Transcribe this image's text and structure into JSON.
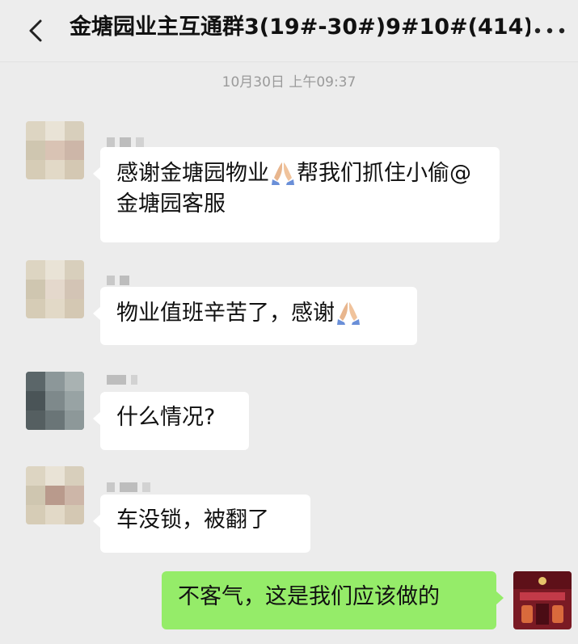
{
  "header": {
    "title": "金塘园业主互通群3(19#-30#)9#10#(414)",
    "back_icon": "chevron-left-icon",
    "more_icon": "more-horizontal-icon"
  },
  "timestamp": "10月30日 上午09:37",
  "colors": {
    "background": "#ececec",
    "incoming_bubble": "#ffffff",
    "outgoing_bubble": "#95ec69"
  },
  "messages": [
    {
      "direction": "incoming",
      "text_before": "感谢金塘园物业",
      "emoji": "folded-hands-icon",
      "text_after": "帮我们抓住小偷@金塘园客服"
    },
    {
      "direction": "incoming",
      "text_before": "物业值班辛苦了，感谢",
      "emoji": "folded-hands-icon"
    },
    {
      "direction": "incoming",
      "text": "什么情况?"
    },
    {
      "direction": "incoming",
      "text": "车没锁，被翻了"
    },
    {
      "direction": "outgoing",
      "text": "不客气，这是我们应该做的"
    }
  ]
}
